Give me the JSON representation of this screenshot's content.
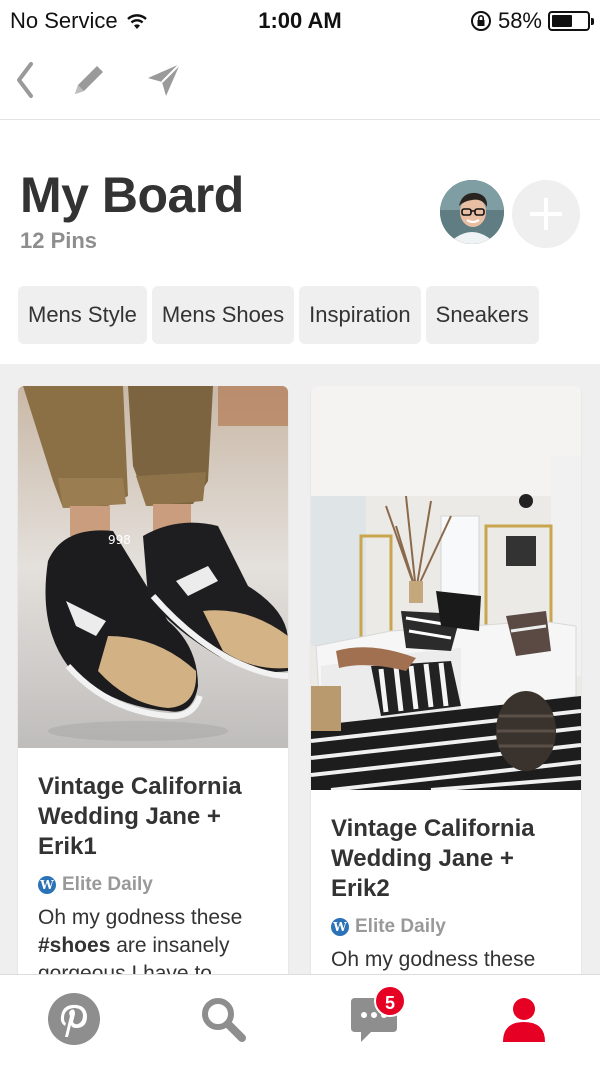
{
  "status_bar": {
    "carrier": "No Service",
    "time": "1:00 AM",
    "battery_percent_label": "58%",
    "battery_level": 0.58,
    "icons": [
      "wifi-icon",
      "orientation-lock-icon",
      "battery-icon"
    ]
  },
  "toolbar": {
    "icons": [
      "back-chevron-icon",
      "pencil-edit-icon",
      "send-arrow-icon"
    ]
  },
  "header": {
    "title": "My Board",
    "pin_count": "12 Pins"
  },
  "chips": [
    "Mens Style",
    "Mens Shoes",
    "Inspiration",
    "Sneakers"
  ],
  "pins": [
    {
      "title": "Vintage California Wedding Jane + Erik1",
      "source": "Elite Daily",
      "desc_before": "Oh my godness these ",
      "desc_bold": "#shoes",
      "desc_after": " are insanely gorgeous I have to",
      "image": "sneakers-photo"
    },
    {
      "title": "Vintage California Wedding Jane + Erik2",
      "source": "Elite Daily",
      "desc_before": "Oh my godness these",
      "desc_bold": "",
      "desc_after": "",
      "image": "living-room-photo"
    }
  ],
  "tabbar": {
    "tabs": [
      "pinterest-home-icon",
      "search-icon",
      "messages-icon",
      "profile-icon"
    ],
    "messages_badge": "5",
    "active_color": "#e60023",
    "inactive_color": "#8e8e8e"
  }
}
